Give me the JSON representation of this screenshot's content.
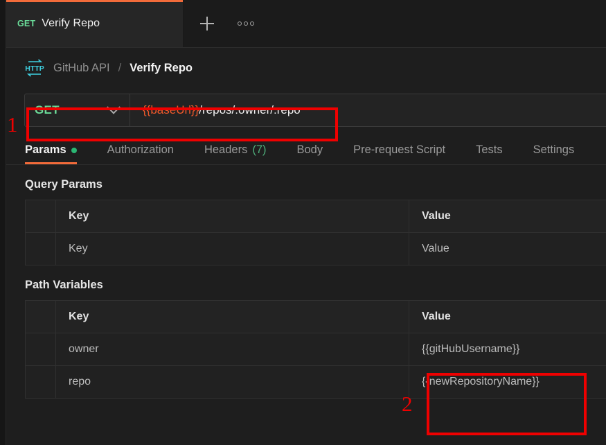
{
  "window": {
    "accent_orange": "#f26b3a",
    "method_green": "#6bdd9a",
    "variable_orange": "#f0592b",
    "annotation_red": "#ef0000"
  },
  "tabstrip": {
    "request_tab": {
      "method": "GET",
      "title": "Verify Repo"
    },
    "new_tab_icon": "plus-icon",
    "more_icon": "ellipsis-icon"
  },
  "breadcrumb": {
    "protocol_icon": "http-icon",
    "parent": "GitHub API",
    "separator": "/",
    "current": "Verify Repo"
  },
  "url_bar": {
    "method": "GET",
    "chevron_icon": "chevron-down-icon",
    "url_variable": "{{baseUrl}}",
    "url_path": "/repos/:owner/:repo"
  },
  "request_tabs": [
    {
      "label": "Params",
      "active": true,
      "dot": true,
      "count": ""
    },
    {
      "label": "Authorization",
      "active": false,
      "dot": false,
      "count": ""
    },
    {
      "label": "Headers",
      "active": false,
      "dot": false,
      "count": "(7)"
    },
    {
      "label": "Body",
      "active": false,
      "dot": false,
      "count": ""
    },
    {
      "label": "Pre-request Script",
      "active": false,
      "dot": false,
      "count": ""
    },
    {
      "label": "Tests",
      "active": false,
      "dot": false,
      "count": ""
    },
    {
      "label": "Settings",
      "active": false,
      "dot": false,
      "count": ""
    }
  ],
  "query_params": {
    "title": "Query Params",
    "headers": {
      "key": "Key",
      "value": "Value"
    },
    "rows": [
      {
        "key": "Key",
        "value": "Value",
        "placeholder": true
      }
    ]
  },
  "path_variables": {
    "title": "Path Variables",
    "headers": {
      "key": "Key",
      "value": "Value"
    },
    "rows": [
      {
        "key": "owner",
        "value": "{{gitHubUsername}}"
      },
      {
        "key": "repo",
        "value": "{{newRepositoryName}}"
      }
    ]
  },
  "annotations": [
    {
      "id": "1",
      "label": "1",
      "target": "url-bar"
    },
    {
      "id": "2",
      "label": "2",
      "target": "path-variable-values"
    }
  ]
}
